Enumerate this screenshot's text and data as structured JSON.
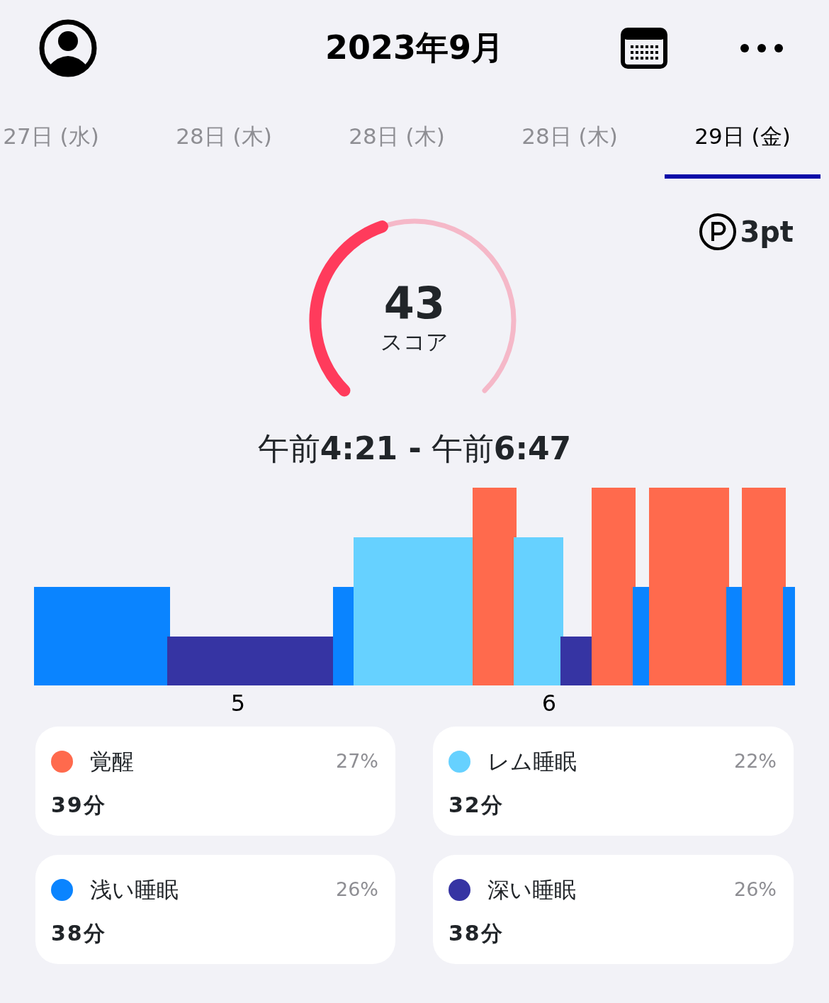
{
  "header": {
    "title": "2023年9月"
  },
  "tabs": [
    {
      "label": "27日 (水)",
      "selected": false
    },
    {
      "label": "28日 (木)",
      "selected": false
    },
    {
      "label": "28日 (木)",
      "selected": false
    },
    {
      "label": "28日 (木)",
      "selected": false
    },
    {
      "label": "29日 (金)",
      "selected": true
    }
  ],
  "score": {
    "value": "43",
    "label": "スコア"
  },
  "points": {
    "value": "3pt"
  },
  "time_range": "午前**4:21 -** 午前**6:47**",
  "hypnogram": {
    "axis_labels": [
      "5",
      "6"
    ]
  },
  "stages": [
    {
      "name": "覚醒",
      "percent": "27%",
      "duration": "39分",
      "color": "#ff6a4d"
    },
    {
      "name": "レム睡眠",
      "percent": "22%",
      "duration": "32分",
      "color": "#66d1ff"
    },
    {
      "name": "浅い睡眠",
      "percent": "26%",
      "duration": "38分",
      "color": "#0a84ff"
    },
    {
      "name": "深い睡眠",
      "percent": "26%",
      "duration": "38分",
      "color": "#3634a3"
    }
  ]
}
